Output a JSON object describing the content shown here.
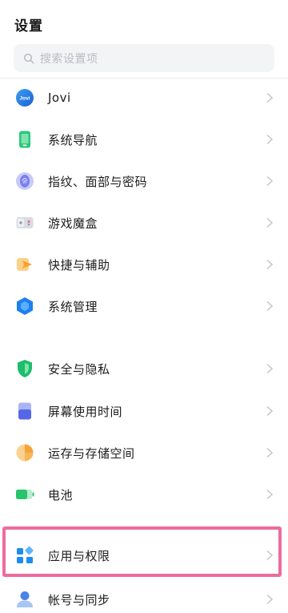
{
  "header": {
    "title": "设置"
  },
  "search": {
    "placeholder": "搜索设置项"
  },
  "sections": [
    {
      "items": [
        {
          "label": "Jovi",
          "icon": "jovi-icon"
        },
        {
          "label": "系统导航",
          "icon": "system-navigation-icon"
        },
        {
          "label": "指纹、面部与密码",
          "icon": "fingerprint-icon"
        },
        {
          "label": "游戏魔盒",
          "icon": "game-box-icon"
        },
        {
          "label": "快捷与辅助",
          "icon": "shortcut-assist-icon"
        },
        {
          "label": "系统管理",
          "icon": "system-management-icon"
        }
      ]
    },
    {
      "items": [
        {
          "label": "安全与隐私",
          "icon": "shield-icon"
        },
        {
          "label": "屏幕使用时间",
          "icon": "screen-time-icon"
        },
        {
          "label": "运存与存储空间",
          "icon": "storage-pie-icon"
        },
        {
          "label": "电池",
          "icon": "battery-icon"
        },
        {
          "label": "应用与权限",
          "icon": "apps-permissions-icon",
          "highlighted": true
        },
        {
          "label": "帐号与同步",
          "icon": "account-sync-icon"
        }
      ]
    }
  ],
  "colors": {
    "highlight_border": "#ec6c9e",
    "chevron": "#c4c6cb",
    "jovi_blue": "#2a7de1",
    "nav_green": "#2bc77a",
    "fingerprint_purple": "#7b7ff0",
    "shortcut_orange": "#f7a032",
    "system_blue": "#1e7ff0",
    "security_green": "#1cbd6b",
    "screen_time_indigo": "#5566e6",
    "storage_orange": "#f4a43a",
    "battery_green": "#27c46b",
    "apps_blue": "#1e8cf0",
    "account_blue": "#4a83e8"
  }
}
